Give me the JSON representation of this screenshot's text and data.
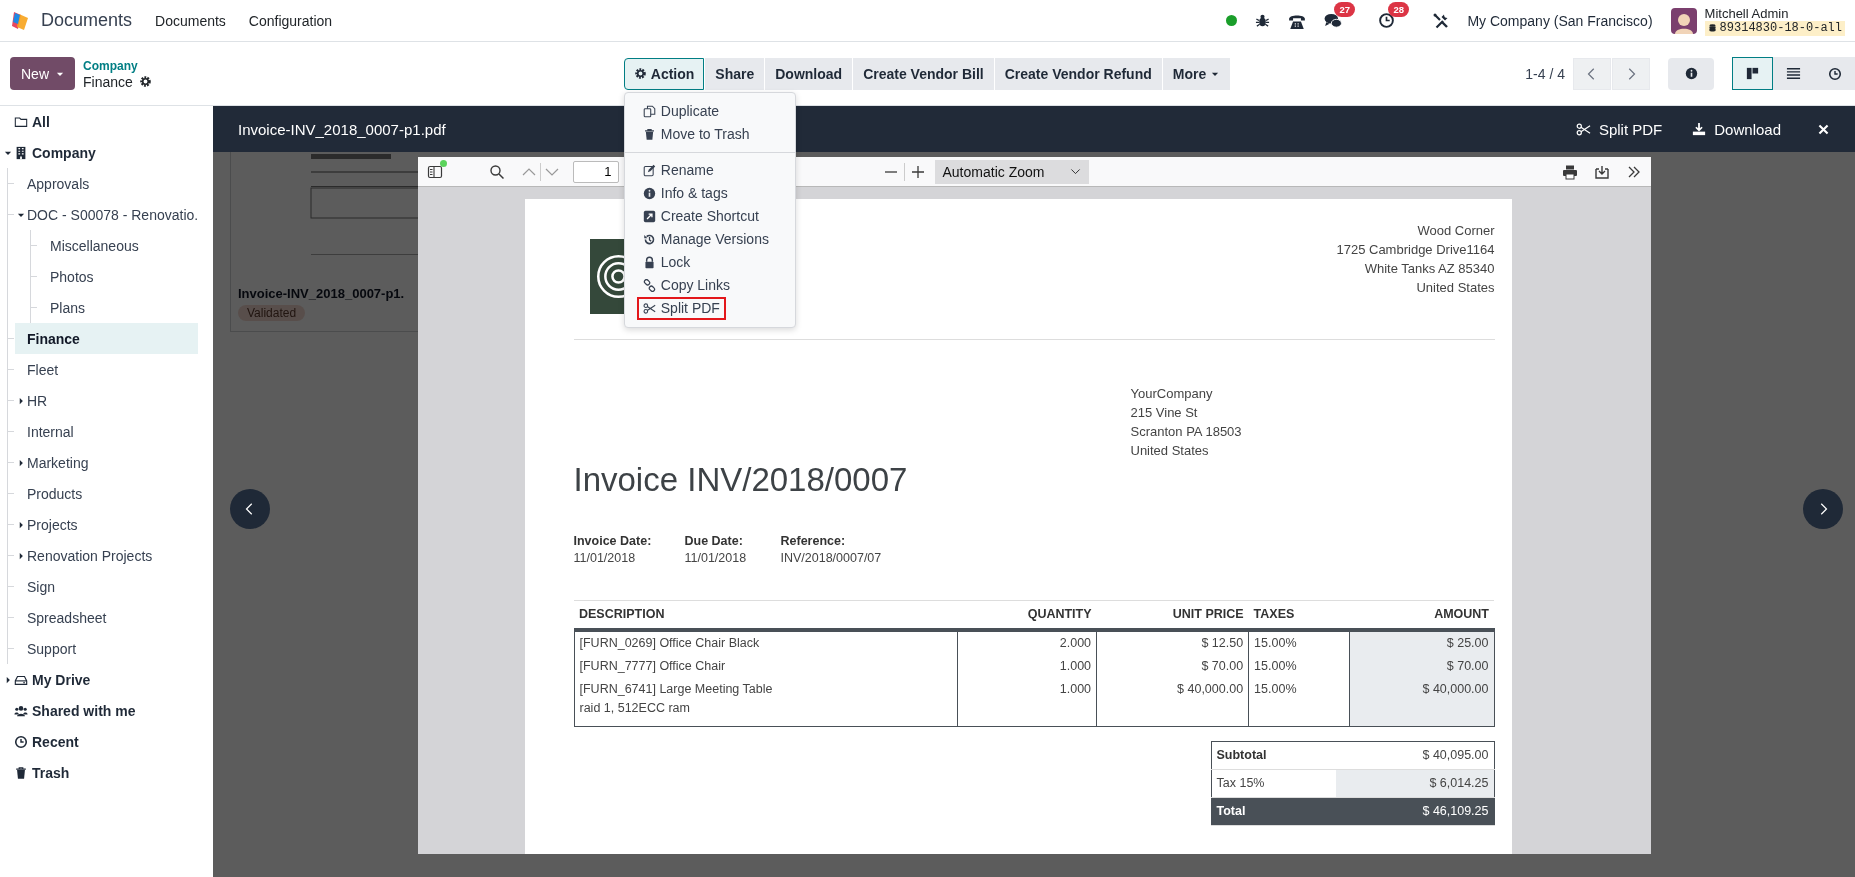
{
  "topbar": {
    "app_name": "Documents",
    "menus": [
      "Documents",
      "Configuration"
    ],
    "chat_count": "27",
    "activity_count": "28",
    "company": "My Company (San Francisco)",
    "user_name": "Mitchell Admin",
    "database": "89314830-18-0-all"
  },
  "control_panel": {
    "new_button": "New",
    "breadcrumb_parent": "Company",
    "breadcrumb_current": "Finance",
    "actions": [
      {
        "label": "Action",
        "selected": true
      },
      {
        "label": "Share",
        "selected": false
      },
      {
        "label": "Download",
        "selected": false
      },
      {
        "label": "Create Vendor Bill",
        "selected": false
      },
      {
        "label": "Create Vendor Refund",
        "selected": false
      },
      {
        "label": "More",
        "selected": false
      }
    ],
    "pager": "1-4 / 4",
    "views": [
      {
        "selected": true
      },
      {
        "selected": false
      },
      {
        "selected": false
      }
    ]
  },
  "sidebar": {
    "items": [
      {
        "label": "All",
        "selected": false
      },
      {
        "label": "Company",
        "selected": false,
        "expanded": true,
        "children": [
          {
            "label": "Approvals",
            "selected": false
          },
          {
            "label": "DOC - S00078 - Renovatio.",
            "selected": false,
            "expanded": true,
            "children": [
              {
                "label": "Miscellaneous",
                "selected": false
              },
              {
                "label": "Photos",
                "selected": false
              },
              {
                "label": "Plans",
                "selected": false
              }
            ]
          },
          {
            "label": "Finance",
            "selected": true
          },
          {
            "label": "Fleet",
            "selected": false
          },
          {
            "label": "HR",
            "selected": false,
            "expanded": false
          },
          {
            "label": "Internal",
            "selected": false
          },
          {
            "label": "Marketing",
            "selected": false,
            "expanded": false
          },
          {
            "label": "Products",
            "selected": false
          },
          {
            "label": "Projects",
            "selected": false,
            "expanded": false
          },
          {
            "label": "Renovation Projects",
            "selected": false,
            "expanded": false
          },
          {
            "label": "Sign",
            "selected": false
          },
          {
            "label": "Spreadsheet",
            "selected": false
          },
          {
            "label": "Support",
            "selected": false
          }
        ]
      },
      {
        "label": "My Drive",
        "selected": false,
        "expanded": false
      },
      {
        "label": "Shared with me",
        "selected": false
      },
      {
        "label": "Recent",
        "selected": false
      },
      {
        "label": "Trash",
        "selected": false
      }
    ]
  },
  "kanban_card": {
    "name": "Invoice-INV_2018_0007-p1.",
    "status": "Validated"
  },
  "preview": {
    "file_name": "Invoice-INV_2018_0007-p1.pdf",
    "split_label": "Split PDF",
    "download_label": "Download"
  },
  "pdf_viewer": {
    "page_number": "1",
    "zoom": "Automatic Zoom"
  },
  "invoice": {
    "vendor_address": [
      "Wood Corner",
      "1725 Cambridge Drive1164",
      "White Tanks AZ 85340",
      "United States"
    ],
    "customer_address": [
      "YourCompany",
      "215 Vine St",
      "Scranton PA 18503",
      "United States"
    ],
    "title": "Invoice INV/2018/0007",
    "info": [
      {
        "label": "Invoice Date:",
        "value": "11/01/2018"
      },
      {
        "label": "Due Date:",
        "value": "11/01/2018"
      },
      {
        "label": "Reference:",
        "value": "INV/2018/0007/07"
      }
    ],
    "table": {
      "columns": [
        "DESCRIPTION",
        "QUANTITY",
        "UNIT PRICE",
        "TAXES",
        "AMOUNT"
      ],
      "rows": [
        {
          "description": "[FURN_0269] Office Chair Black",
          "quantity": "2.000",
          "unit_price": "$ 12.50",
          "taxes": "15.00%",
          "amount": "$ 25.00"
        },
        {
          "description": "[FURN_7777] Office Chair",
          "quantity": "1.000",
          "unit_price": "$ 70.00",
          "taxes": "15.00%",
          "amount": "$ 70.00"
        },
        {
          "description": "[FURN_6741] Large Meeting Table\nraid 1, 512ECC ram",
          "quantity": "1.000",
          "unit_price": "$ 40,000.00",
          "taxes": "15.00%",
          "amount": "$ 40,000.00"
        }
      ]
    },
    "totals": [
      {
        "kind": "subtotal",
        "label": "Subtotal",
        "value": "$ 40,095.00"
      },
      {
        "kind": "tax",
        "label": "Tax 15%",
        "value": "$ 6,014.25"
      },
      {
        "kind": "total",
        "label": "Total",
        "value": "$ 46,109.25"
      }
    ]
  },
  "action_menu": {
    "groups": [
      [
        {
          "label": "Duplicate",
          "highlighted": false
        },
        {
          "label": "Move to Trash",
          "highlighted": false
        }
      ],
      [
        {
          "label": "Rename",
          "highlighted": false
        },
        {
          "label": "Info & tags",
          "highlighted": false
        },
        {
          "label": "Create Shortcut",
          "highlighted": false
        },
        {
          "label": "Manage Versions",
          "highlighted": false
        },
        {
          "label": "Lock",
          "highlighted": false
        },
        {
          "label": "Copy Links",
          "highlighted": false
        },
        {
          "label": "Split PDF",
          "highlighted": true
        }
      ]
    ]
  }
}
